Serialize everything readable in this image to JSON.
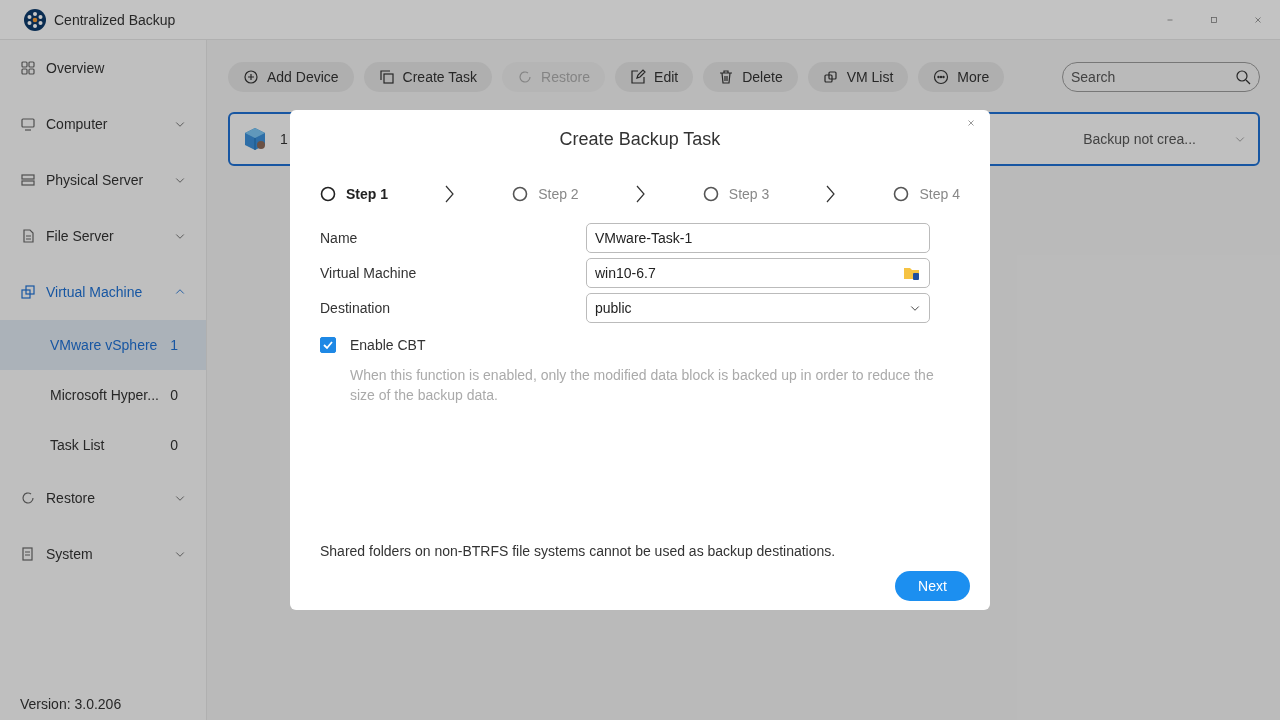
{
  "app": {
    "title": "Centralized Backup"
  },
  "sidebar": {
    "items": [
      {
        "label": "Overview"
      },
      {
        "label": "Computer",
        "expanded": false
      },
      {
        "label": "Physical Server",
        "expanded": false
      },
      {
        "label": "File Server",
        "expanded": false
      },
      {
        "label": "Virtual Machine",
        "expanded": true,
        "selected": true,
        "children": [
          {
            "label": "VMware vSphere",
            "count": "1",
            "selected": true
          },
          {
            "label": "Microsoft Hyper...",
            "count": "0",
            "selected": false
          },
          {
            "label": "Task List",
            "count": "0",
            "selected": false
          }
        ]
      },
      {
        "label": "Restore",
        "expanded": false
      },
      {
        "label": "System",
        "expanded": false
      }
    ],
    "version": "Version: 3.0.206"
  },
  "toolbar": {
    "buttons": [
      {
        "label": "Add Device",
        "disabled": false
      },
      {
        "label": "Create Task",
        "disabled": false
      },
      {
        "label": "Restore",
        "disabled": true
      },
      {
        "label": "Edit",
        "disabled": false
      },
      {
        "label": "Delete",
        "disabled": false
      },
      {
        "label": "VM List",
        "disabled": false
      },
      {
        "label": "More",
        "disabled": false
      }
    ],
    "search": {
      "placeholder": "Search"
    }
  },
  "device": {
    "name": "1",
    "status": "Backup not crea..."
  },
  "dialog": {
    "title": "Create Backup Task",
    "steps": [
      {
        "label": "Step 1",
        "selected": true
      },
      {
        "label": "Step 2",
        "selected": false
      },
      {
        "label": "Step 3",
        "selected": false
      },
      {
        "label": "Step 4",
        "selected": false
      }
    ],
    "fields": [
      {
        "label": "Name",
        "value": "VMware-Task-1",
        "kind": "text"
      },
      {
        "label": "Virtual Machine",
        "value": "win10-6.7",
        "kind": "picker"
      },
      {
        "label": "Destination",
        "value": "public",
        "kind": "select"
      }
    ],
    "option": {
      "label": "Enable CBT",
      "checked": true,
      "description": "When this function is enabled, only the modified data block is backed up in order to reduce the size of the backup data."
    },
    "note": "Shared folders on non-BTRFS file systems cannot be used as backup destinations.",
    "next": "Next"
  }
}
